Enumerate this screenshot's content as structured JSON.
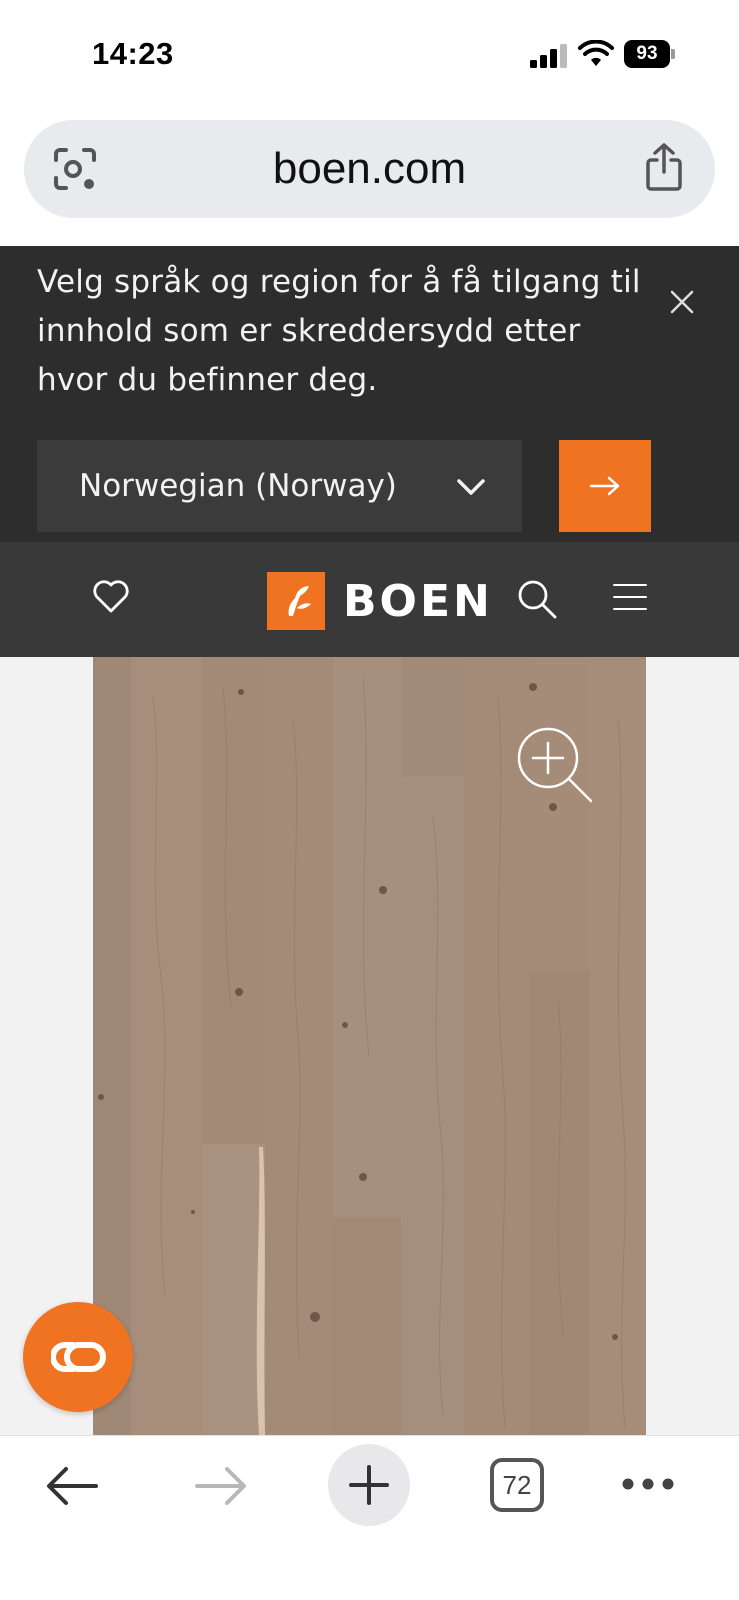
{
  "status_bar": {
    "time": "14:23",
    "battery": "93",
    "icons": [
      "signal-icon",
      "wifi-icon",
      "battery-icon"
    ]
  },
  "address_bar": {
    "url": "boen.com",
    "icons": [
      "camera-search-icon",
      "share-icon"
    ]
  },
  "region_banner": {
    "message": "Velg språk og region for å få tilgang til innhold som er skreddersydd etter hvor du befinner deg.",
    "selected_region": "Norwegian (Norway)",
    "icons": [
      "close-icon",
      "chevron-down-icon",
      "arrow-right-icon"
    ],
    "accent_color": "#f07322"
  },
  "site_header": {
    "logo_text": "BOEN",
    "icons": [
      "heart-icon",
      "search-icon",
      "menu-icon"
    ],
    "background": "#393939"
  },
  "product": {
    "icons": [
      "zoom-in-icon"
    ]
  },
  "chat": {
    "icon": "chat-icon",
    "color": "#f07322"
  },
  "toolbar": {
    "tab_count": "72",
    "icons": [
      "back-icon",
      "forward-icon",
      "new-tab-icon",
      "tabs-icon",
      "more-icon"
    ]
  }
}
